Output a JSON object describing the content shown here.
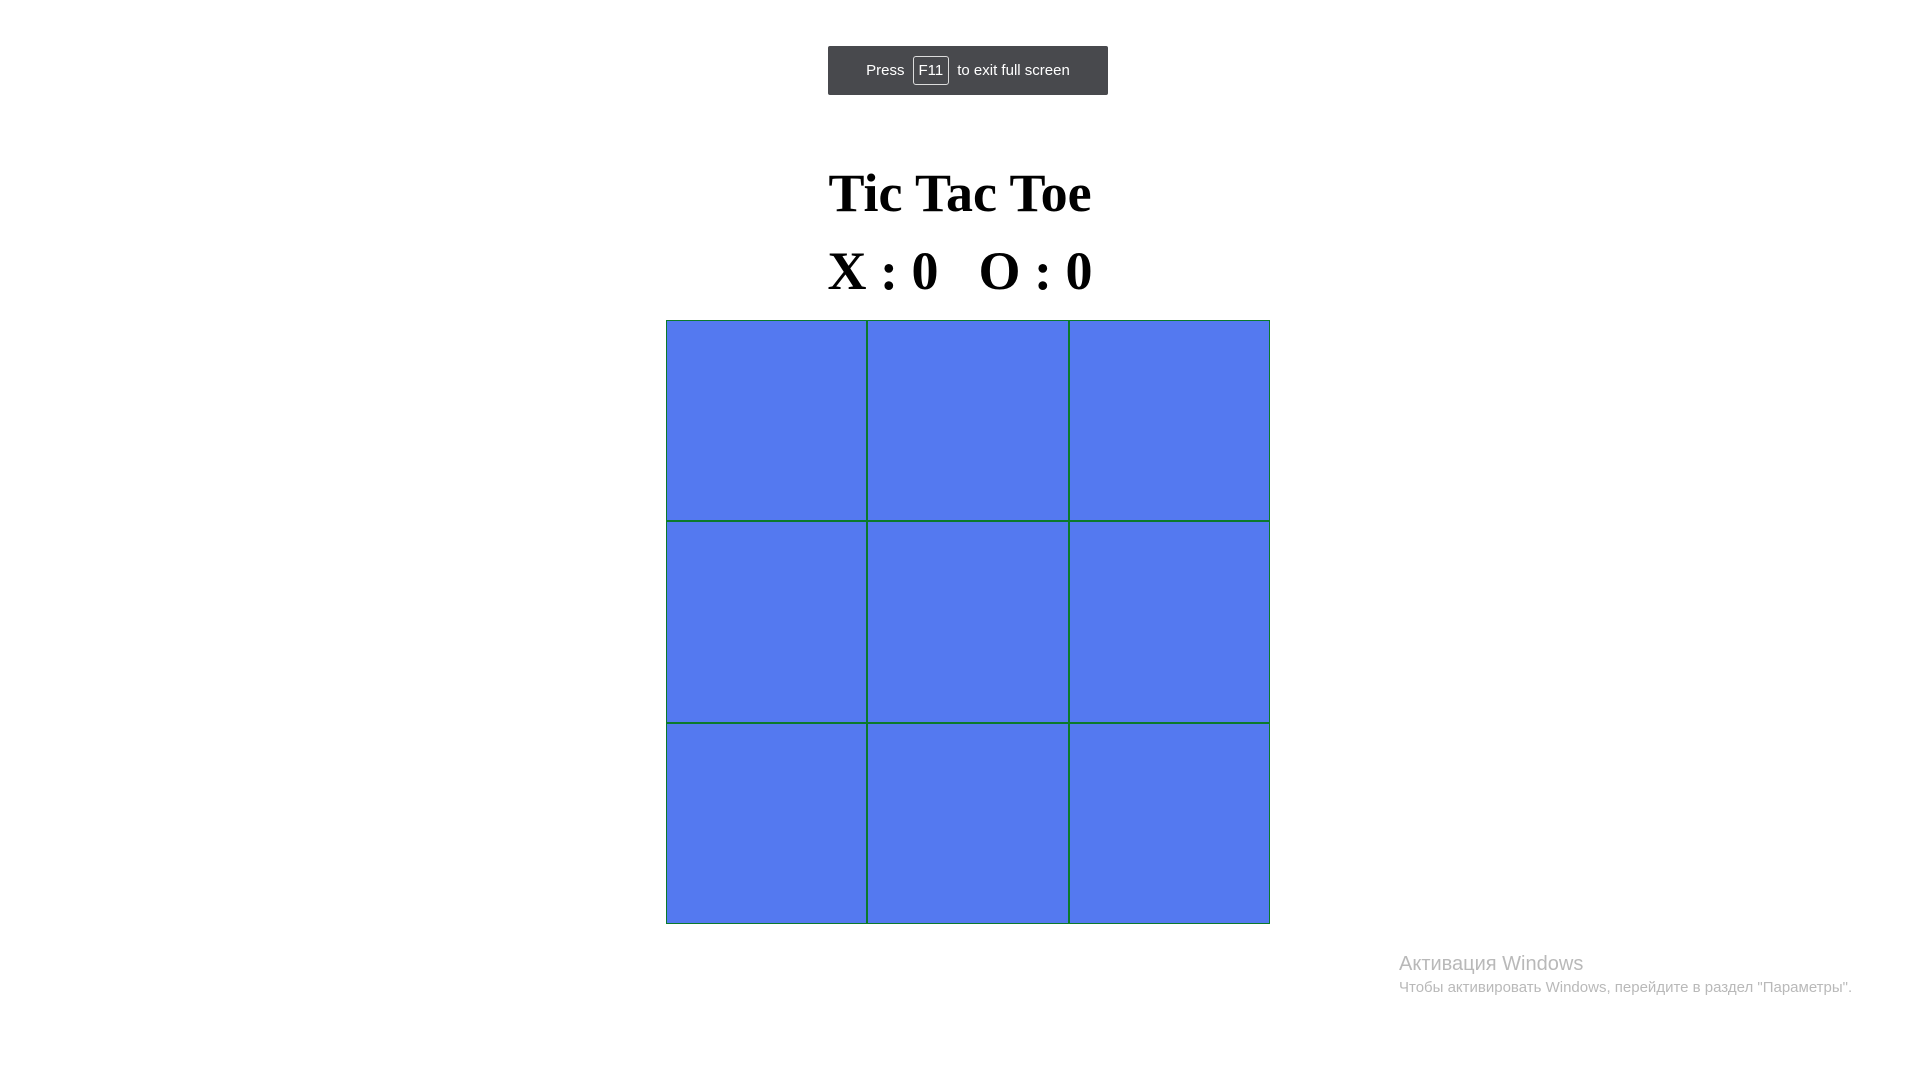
{
  "fullscreen_notice": {
    "prefix": "Press",
    "key": "F11",
    "suffix": "to exit full screen"
  },
  "game": {
    "title": "Tic Tac Toe",
    "score": {
      "x_label": "X : 0",
      "o_label": "O : 0"
    },
    "board": {
      "cells": [
        "",
        "",
        "",
        "",
        "",
        "",
        "",
        "",
        ""
      ],
      "cell_color": "#5479f0",
      "line_color": "#0b7a2b"
    }
  },
  "windows_watermark": {
    "title": "Активация Windows",
    "text": "Чтобы активировать Windows, перейдите в раздел \"Параметры\"."
  }
}
